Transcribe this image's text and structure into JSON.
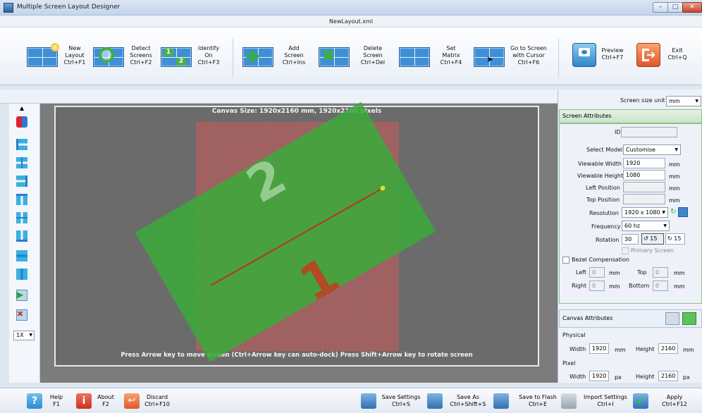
{
  "window": {
    "title": "Multiple Screen Layout Designer",
    "file_name": "NewLayout.xml"
  },
  "toolbar": {
    "new_layout": "New\nLayout\nCtrl+F1",
    "detect_screens": "Detect\nScreens\nCtrl+F2",
    "identify_on": "Identify\nOn\nCtrl+F3",
    "add_screen": "Add\nScreen\nCtrl+Ins",
    "delete_screen": "Delete\nScreen\nCtrl+Del",
    "set_matrix": "Set\nMatrix\nCtrl+F4",
    "go_to_screen": "Go to Screen\nwith Cursor\nCtrl+F6",
    "preview": "Preview\nCtrl+F7",
    "exit": "Exit\nCtrl+Q",
    "identify_digits": [
      "1",
      "2"
    ]
  },
  "canvas": {
    "size_text": "Canvas Size: 1920x2160 mm, 1920x2160 pixels",
    "hint_text": "Press Arrow key to move screen (Ctrl+Arrow key can auto-dock)    Press Shift+Arrow key to rotate screen",
    "screen_labels": [
      "2",
      "1"
    ],
    "zoom_select": "1X"
  },
  "right_panel": {
    "screen_size_unit_label": "Screen size unit",
    "screen_size_unit_value": "mm",
    "screen_attributes_title": "Screen Attributes",
    "id_label": "ID",
    "id_value": "",
    "select_model_label": "Select Model",
    "select_model_value": "Customise",
    "viewable_width_label": "Viewable Width",
    "viewable_width_value": "1920",
    "viewable_height_label": "Viewable Height",
    "viewable_height_value": "1080",
    "left_position_label": "Left Position",
    "top_position_label": "Top Position",
    "unit_mm": "mm",
    "resolution_label": "Resolution",
    "resolution_value": "1920 x 1080",
    "frequency_label": "Frequency",
    "frequency_value": "60 hz",
    "rotation_label": "Rotation",
    "rotation_value": "30",
    "rotate_ccw_step": "15",
    "rotate_cw_step": "15",
    "primary_screen_label": "Primary Screen",
    "bezel_label": "Bezel Compensation",
    "bezel_left_label": "Left",
    "bezel_left_value": "0",
    "bezel_top_label": "Top",
    "bezel_top_value": "0",
    "bezel_right_label": "Right",
    "bezel_right_value": "0",
    "bezel_bottom_label": "Bottom",
    "bezel_bottom_value": "0",
    "canvas_attributes_title": "Canvas Attributes",
    "physical_label": "Physical",
    "physical_width_label": "Width",
    "physical_width_value": "1920",
    "physical_height_label": "Height",
    "physical_height_value": "2160",
    "pixel_label": "Pixel",
    "pixel_width_label": "Width",
    "pixel_width_value": "1920",
    "pixel_height_label": "Height",
    "pixel_height_value": "2160",
    "unit_px": "px"
  },
  "bottombar": {
    "help": "Help\nF1",
    "about": "About\nF2",
    "discard": "Discard\nCtrl+F10",
    "save_settings": "Save Settings\nCtrl+S",
    "save_as": "Save As\nCtrl+Shift+S",
    "save_to_flash": "Save to Flash\nCtrl+E",
    "import_settings": "Import Settings\nCtrl+I",
    "apply": "Apply\nCtrl+F12"
  },
  "colors": {
    "screen_green": "#3aaa3a",
    "grid_red": "#d24646",
    "accent_blue": "#3f8fd6"
  }
}
